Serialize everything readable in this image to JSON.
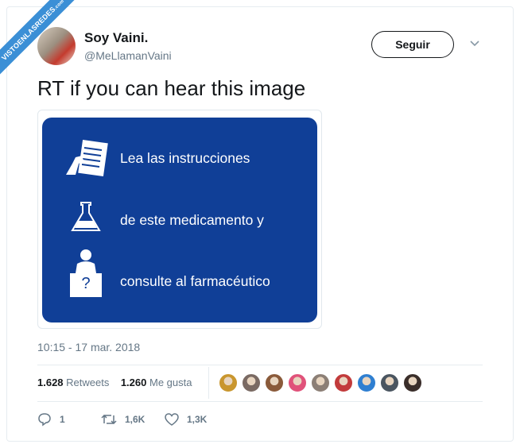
{
  "watermark": {
    "text": "VISTOENLASREDES",
    "suffix": ".com"
  },
  "author": {
    "name": "Soy Vaini.",
    "handle": "@MeLlamanVaini"
  },
  "follow_label": "Seguir",
  "tweet_text": "RT if you can hear this image",
  "sign": {
    "lines": [
      "Lea las instrucciones",
      "de este medicamento y",
      "consulte al farmacéutico"
    ],
    "question_mark": "?",
    "color": "#103f97"
  },
  "timestamp": "10:15 - 17 mar. 2018",
  "stats": {
    "retweets_count": "1.628",
    "retweets_label": "Retweets",
    "likes_count": "1.260",
    "likes_label": "Me gusta"
  },
  "liker_avatars": [
    "#c9962e",
    "#7a6a63",
    "#8a5a3a",
    "#e0527a",
    "#8c7f76",
    "#c23b3b",
    "#2f7fd1",
    "#4a5560",
    "#3a2e2a"
  ],
  "actions": {
    "replies": "1",
    "retweets": "1,6K",
    "likes": "1,3K"
  },
  "icons": [
    "chevron-down-icon",
    "document-hand-icon",
    "flask-icon",
    "pharmacist-icon",
    "reply-icon",
    "retweet-icon",
    "heart-icon"
  ]
}
